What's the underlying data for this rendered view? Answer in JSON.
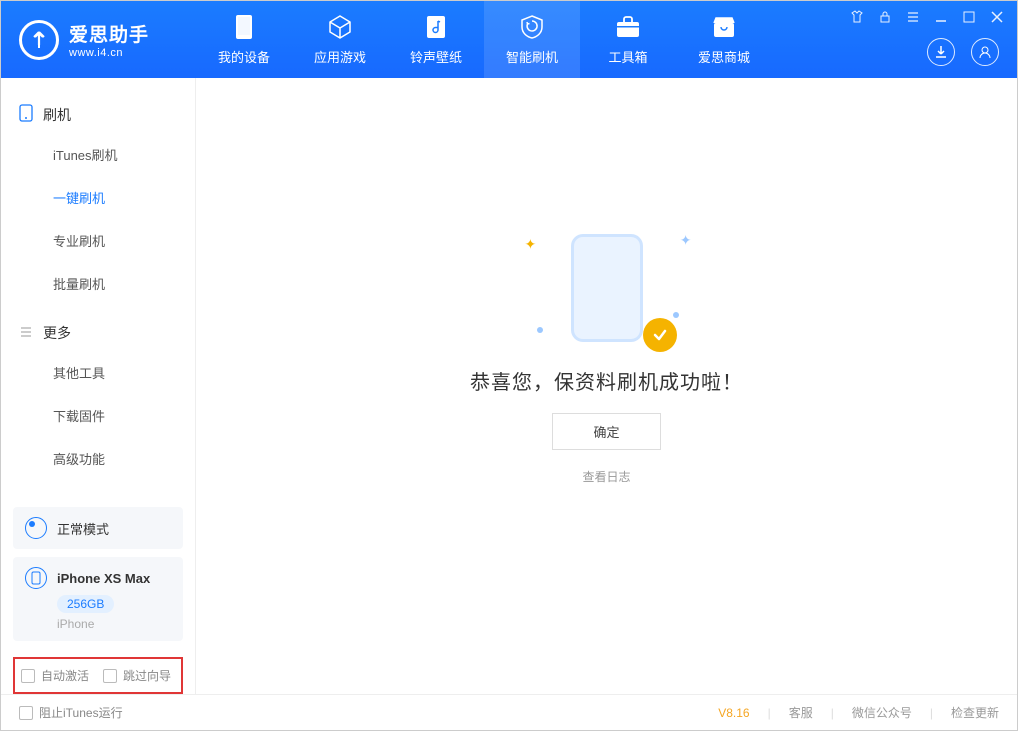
{
  "app": {
    "title": "爱思助手",
    "subtitle": "www.i4.cn"
  },
  "nav": [
    {
      "label": "我的设备"
    },
    {
      "label": "应用游戏"
    },
    {
      "label": "铃声壁纸"
    },
    {
      "label": "智能刷机"
    },
    {
      "label": "工具箱"
    },
    {
      "label": "爱思商城"
    }
  ],
  "sidebar": {
    "group1_title": "刷机",
    "group1_items": [
      "iTunes刷机",
      "一键刷机",
      "专业刷机",
      "批量刷机"
    ],
    "group2_title": "更多",
    "group2_items": [
      "其他工具",
      "下载固件",
      "高级功能"
    ]
  },
  "device_mode": {
    "label": "正常模式"
  },
  "device": {
    "name": "iPhone XS Max",
    "storage": "256GB",
    "type": "iPhone"
  },
  "options": {
    "auto_activate": "自动激活",
    "skip_guide": "跳过向导"
  },
  "main": {
    "message": "恭喜您，保资料刷机成功啦！",
    "ok_label": "确定",
    "log_link": "查看日志"
  },
  "footer": {
    "block_itunes": "阻止iTunes运行",
    "version": "V8.16",
    "link1": "客服",
    "link2": "微信公众号",
    "link3": "检查更新"
  }
}
